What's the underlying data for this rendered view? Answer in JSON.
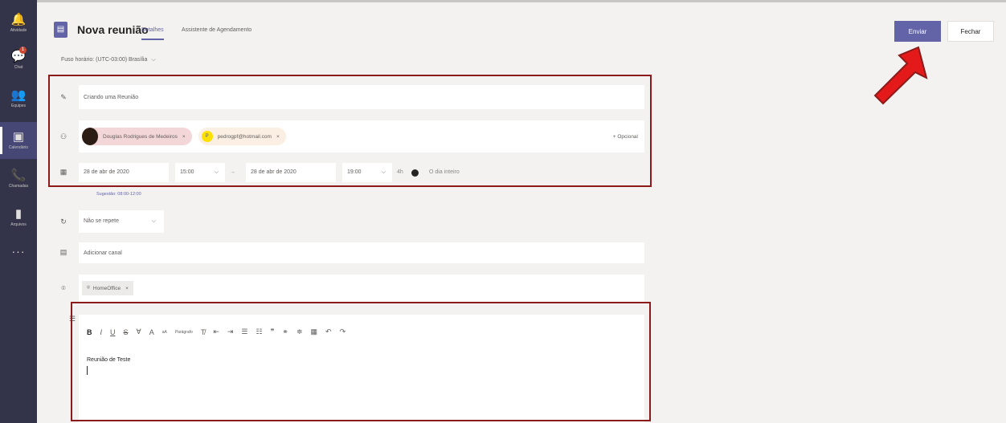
{
  "rail": {
    "items": [
      {
        "label": "Atividade",
        "icon": "bell-icon",
        "glyph": "🔔"
      },
      {
        "label": "Chat",
        "icon": "chat-icon",
        "glyph": "💬",
        "badge": "1"
      },
      {
        "label": "Equipes",
        "icon": "teams-icon",
        "glyph": "👥"
      },
      {
        "label": "Calendário",
        "icon": "calendar-icon",
        "glyph": "▣"
      },
      {
        "label": "Chamadas",
        "icon": "phone-icon",
        "glyph": "📞"
      },
      {
        "label": "Arquivos",
        "icon": "files-icon",
        "glyph": "▮"
      }
    ],
    "more": "···"
  },
  "header": {
    "title": "Nova reunião",
    "tabs": [
      "Detalhes",
      "Assistente de Agendamento"
    ],
    "send_label": "Enviar",
    "close_label": "Fechar",
    "timezone": "Fuso horário: (UTC-03:00) Brasília"
  },
  "form": {
    "title_value": "Criando uma Reunião",
    "attendees": [
      {
        "name": "Douglas Rodrigues de Medeiros",
        "initial": ""
      },
      {
        "name": "pedrogpf@hotmail.com",
        "initial": "P"
      }
    ],
    "optional_label": "+ Opcional",
    "start_date": "28 de abr de 2020",
    "start_time": "15:00",
    "end_date": "28 de abr de 2020",
    "end_time": "19:00",
    "duration": "4h",
    "all_day_label": "O dia inteiro",
    "suggestion": "Sugestão: 08:00-12:00",
    "repeat_value": "Não se repete",
    "channel_placeholder": "Adicionar canal",
    "location": "HomeOffice",
    "body_text": "Reunião de Teste",
    "toolbar_paragraph": "Parágrafo"
  },
  "colors": {
    "accent": "#6264a7",
    "rail": "#33344a",
    "annotation": "#8b1a1a",
    "arrow": "#e41a1a"
  }
}
